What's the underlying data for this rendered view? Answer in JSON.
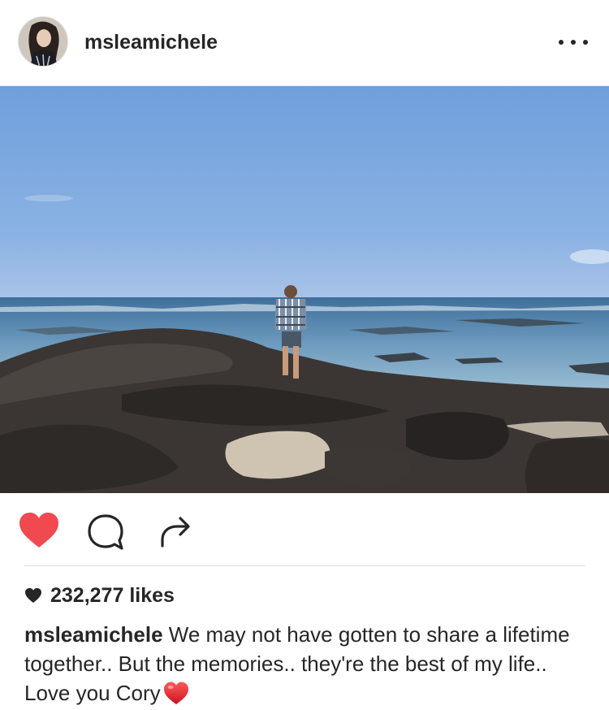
{
  "post": {
    "username": "msleamichele",
    "more_icon": "more-options-icon",
    "photo_alt": "",
    "liked": true,
    "colors": {
      "like_red": "#f0494f",
      "text": "#262626",
      "divider": "#dbdbdb"
    },
    "actions": {
      "like_icon": "heart-icon",
      "comment_icon": "comment-bubble-icon",
      "share_icon": "share-arrow-icon"
    },
    "likes": {
      "count_label": "232,277 likes"
    },
    "caption": {
      "username": "msleamichele",
      "text": "We may not have gotten to share a lifetime together.. But the memories.. they're the best of my life.. Love you Cory",
      "emoji": "red-heart-emoji"
    }
  }
}
